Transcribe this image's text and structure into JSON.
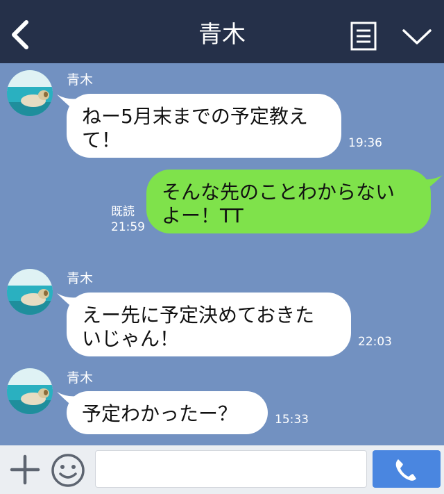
{
  "header": {
    "title": "青木"
  },
  "messages": [
    {
      "direction": "in",
      "sender": "青木",
      "text": "ねー5月末までの予定教え\nて！",
      "time": "19:36"
    },
    {
      "direction": "out",
      "text": "そんな先のことわからない\nよー！TT",
      "read_label": "既読",
      "time": "21:59"
    },
    {
      "direction": "in",
      "sender": "青木",
      "text": "えー先に予定決めておきた\nいじゃん！",
      "time": "22:03"
    },
    {
      "direction": "in",
      "sender": "青木",
      "text": "予定わかったー？",
      "time": "15:33"
    }
  ],
  "input": {
    "value": "",
    "placeholder": ""
  },
  "colors": {
    "header_bg": "#253049",
    "chat_bg": "#7291c1",
    "incoming_bubble": "#ffffff",
    "outgoing_bubble": "#7fe24b",
    "call_button": "#4a86e0"
  },
  "icons": {
    "back": "chevron-left-icon",
    "menu": "menu-list-icon",
    "collapse": "chevron-down-icon",
    "plus": "plus-icon",
    "emoji": "smiley-icon",
    "call": "phone-icon"
  }
}
